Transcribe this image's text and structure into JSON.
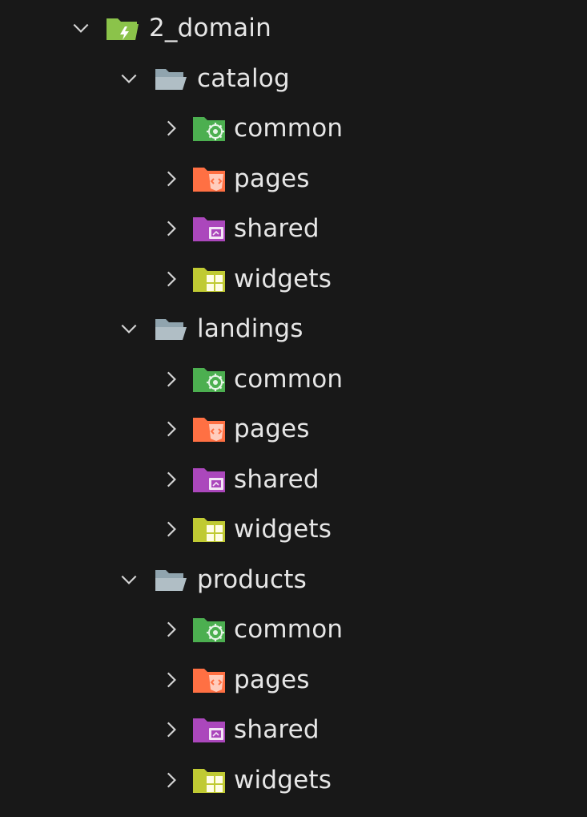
{
  "explorer": {
    "root": {
      "label": "2_domain",
      "expanded": true,
      "icon": "domain-folder-open-icon",
      "color": "#8bc34a"
    },
    "groups": [
      {
        "label": "catalog",
        "expanded": true,
        "icon": "folder-open-icon",
        "children": [
          {
            "label": "common",
            "icon": "common-folder-icon",
            "color": "#4caf50"
          },
          {
            "label": "pages",
            "icon": "pages-folder-icon",
            "color": "#ff7043"
          },
          {
            "label": "shared",
            "icon": "shared-folder-icon",
            "color": "#ab47bc"
          },
          {
            "label": "widgets",
            "icon": "widgets-folder-icon",
            "color": "#c0ca33"
          }
        ]
      },
      {
        "label": "landings",
        "expanded": true,
        "icon": "folder-open-icon",
        "children": [
          {
            "label": "common",
            "icon": "common-folder-icon",
            "color": "#4caf50"
          },
          {
            "label": "pages",
            "icon": "pages-folder-icon",
            "color": "#ff7043"
          },
          {
            "label": "shared",
            "icon": "shared-folder-icon",
            "color": "#ab47bc"
          },
          {
            "label": "widgets",
            "icon": "widgets-folder-icon",
            "color": "#c0ca33"
          }
        ]
      },
      {
        "label": "products",
        "expanded": true,
        "icon": "folder-open-icon",
        "children": [
          {
            "label": "common",
            "icon": "common-folder-icon",
            "color": "#4caf50"
          },
          {
            "label": "pages",
            "icon": "pages-folder-icon",
            "color": "#ff7043"
          },
          {
            "label": "shared",
            "icon": "shared-folder-icon",
            "color": "#ab47bc"
          },
          {
            "label": "widgets",
            "icon": "widgets-folder-icon",
            "color": "#c0ca33"
          }
        ]
      }
    ]
  }
}
